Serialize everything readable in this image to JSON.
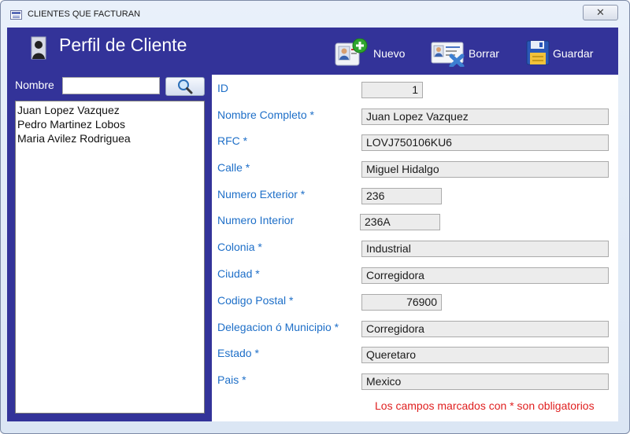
{
  "window": {
    "title": "CLIENTES QUE FACTURAN",
    "close_glyph": "✕"
  },
  "header": {
    "title": "Perfil de Cliente",
    "icon": "person-silhouette-icon"
  },
  "toolbar": {
    "new_label": "Nuevo",
    "delete_label": "Borrar",
    "save_label": "Guardar"
  },
  "search": {
    "label": "Nombre",
    "value": ""
  },
  "clients": [
    "Juan Lopez Vazquez",
    "Pedro Martinez Lobos",
    "Maria Avilez Rodriguea"
  ],
  "fields": {
    "id": {
      "label": "ID",
      "value": "1"
    },
    "nombre": {
      "label": "Nombre Completo *",
      "value": "Juan Lopez Vazquez"
    },
    "rfc": {
      "label": "RFC *",
      "value": "LOVJ750106KU6"
    },
    "calle": {
      "label": "Calle *",
      "value": "Miguel Hidalgo"
    },
    "num_ext": {
      "label": "Numero Exterior *",
      "value": "236"
    },
    "num_int": {
      "label": "Numero Interior",
      "value": "236A"
    },
    "colonia": {
      "label": "Colonia *",
      "value": "Industrial"
    },
    "ciudad": {
      "label": "Ciudad *",
      "value": "Corregidora"
    },
    "cp": {
      "label": "Codigo Postal *",
      "value": "76900"
    },
    "delegacion": {
      "label": "Delegacion ó Municipio *",
      "value": "Corregidora"
    },
    "estado": {
      "label": "Estado *",
      "value": "Queretaro"
    },
    "pais": {
      "label": "Pais *",
      "value": "Mexico"
    }
  },
  "required_note": "Los campos marcados con * son obligatorios",
  "colors": {
    "frame": "#333399",
    "label": "#1e6fc8",
    "note": "#e02020"
  }
}
